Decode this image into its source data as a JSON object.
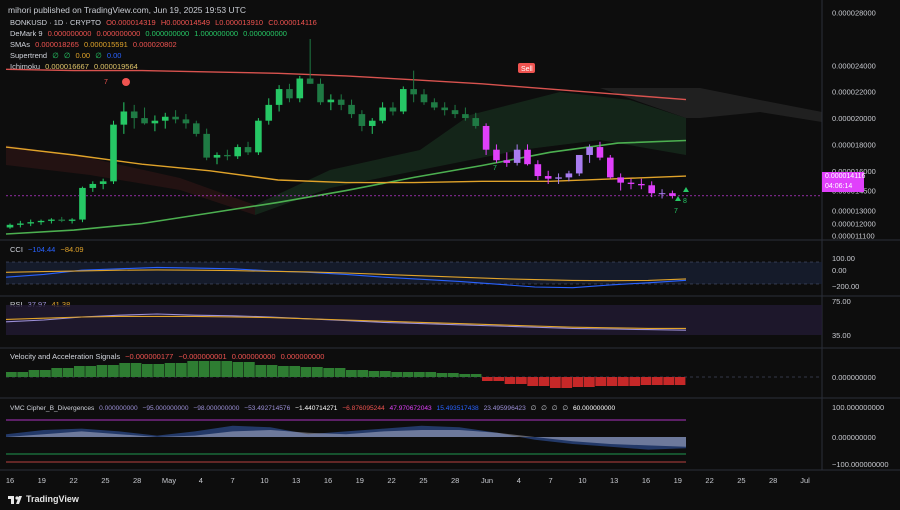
{
  "header": "mihori published on TradingView.com, Jun 19, 2025 19:53 UTC",
  "brand": "TradingView",
  "legends": {
    "main": {
      "symbol": "BONKUSD · 1D · CRYPTO",
      "o": "O0.000014319",
      "h": "H0.000014549",
      "l": "L0.000013910",
      "c": "C0.000014116"
    },
    "demark": {
      "name": "DeMark 9",
      "vals": [
        "0.000000000",
        "0.000000000",
        "0.000000000",
        "1.000000000",
        "0.000000000"
      ]
    },
    "smas": {
      "name": "SMAs",
      "vals": [
        "0.000018265",
        "0.000015591",
        "0.000020802"
      ]
    },
    "supertrend": {
      "name": "Supertrend",
      "vals": [
        "∅",
        "∅",
        "0.00",
        "∅",
        "0.00"
      ]
    },
    "ichimoku": {
      "name": "Ichimoku",
      "vals": [
        "0.000016667",
        "0.000019564"
      ]
    },
    "cci": {
      "name": "CCI",
      "vals": [
        "−104.44",
        "−84.09"
      ]
    },
    "rsi": {
      "name": "RSI",
      "vals": [
        "37.97",
        "41.38"
      ]
    },
    "vel": {
      "name": "Velocity and Acceleration Signals",
      "vals": [
        "−0.000000177",
        "−0.000000001",
        "0.000000000",
        "0.000000000"
      ]
    },
    "vmc": {
      "name": "VMC Cipher_B_Divergences",
      "vals": [
        "0.000000000",
        "−95.000000000",
        "−98.000000000",
        "−53.492714576",
        "−1.440714271",
        "−6.876095244",
        "47.970672043",
        "15.493517438",
        "23.495996423",
        "∅",
        "∅",
        "∅",
        "∅",
        "60.000000000"
      ]
    }
  },
  "annotations": {
    "sell": "Sell",
    "seven_top": "7",
    "seven_mid": "7",
    "seven_low": "7",
    "eight_low": "8"
  },
  "price_box": {
    "price": "0.000014116",
    "countdown": "04:06:14"
  },
  "axes": {
    "price_ticks": [
      "0.000028000",
      "0.000024000",
      "0.000022000",
      "0.000020000",
      "0.000018000",
      "0.000016000",
      "0.000014500",
      "0.000013000",
      "0.000012000",
      "0.000011100"
    ],
    "cci_ticks": [
      "100.00",
      "0.00",
      "−200.00"
    ],
    "rsi_ticks": [
      "75.00",
      "35.00"
    ],
    "vel_ticks": [
      "0.000000000"
    ],
    "vmc_ticks": [
      "100.000000000",
      "0.000000000",
      "−100.000000000"
    ],
    "x_ticks": [
      "16",
      "19",
      "22",
      "25",
      "28",
      "May",
      "4",
      "7",
      "10",
      "13",
      "16",
      "19",
      "22",
      "25",
      "28",
      "Jun",
      "4",
      "7",
      "10",
      "13",
      "16",
      "19",
      "22",
      "25",
      "28",
      "Jul"
    ]
  },
  "colors": {
    "up": "#26c765",
    "down": "#e040fb",
    "sma_green": "#4caf50",
    "sma_yellow": "#e0a32a",
    "sma_red": "#d9534f",
    "cci": "#2962ff",
    "rsi": "#9b8fd6"
  },
  "chart_data": {
    "type": "candlestick",
    "symbol": "BONKUSD",
    "timeframe": "1D",
    "x_start": "2025-04-16",
    "ylim": [
      1.09e-05,
      2.82e-05
    ],
    "candles": [
      [
        1.17e-05,
        1.2e-05,
        1.16e-05,
        1.19e-05
      ],
      [
        1.19e-05,
        1.22e-05,
        1.17e-05,
        1.2e-05
      ],
      [
        1.2e-05,
        1.23e-05,
        1.18e-05,
        1.21e-05
      ],
      [
        1.21e-05,
        1.23e-05,
        1.19e-05,
        1.22e-05
      ],
      [
        1.22e-05,
        1.24e-05,
        1.2e-05,
        1.23e-05
      ],
      [
        1.23e-05,
        1.25e-05,
        1.21e-05,
        1.22e-05
      ],
      [
        1.22e-05,
        1.24e-05,
        1.2e-05,
        1.23e-05
      ],
      [
        1.23e-05,
        1.48e-05,
        1.21e-05,
        1.47e-05
      ],
      [
        1.47e-05,
        1.52e-05,
        1.44e-05,
        1.5e-05
      ],
      [
        1.5e-05,
        1.54e-05,
        1.46e-05,
        1.52e-05
      ],
      [
        1.52e-05,
        1.98e-05,
        1.5e-05,
        1.95e-05
      ],
      [
        1.95e-05,
        2.12e-05,
        1.88e-05,
        2.05e-05
      ],
      [
        2.05e-05,
        2.1e-05,
        1.92e-05,
        2e-05
      ],
      [
        2e-05,
        2.08e-05,
        1.95e-05,
        1.96e-05
      ],
      [
        1.96e-05,
        2.02e-05,
        1.9e-05,
        1.98e-05
      ],
      [
        1.98e-05,
        2.04e-05,
        1.92e-05,
        2.01e-05
      ],
      [
        2.01e-05,
        2.06e-05,
        1.96e-05,
        1.99e-05
      ],
      [
        1.99e-05,
        2.03e-05,
        1.92e-05,
        1.96e-05
      ],
      [
        1.96e-05,
        1.98e-05,
        1.86e-05,
        1.88e-05
      ],
      [
        1.88e-05,
        1.92e-05,
        1.68e-05,
        1.7e-05
      ],
      [
        1.7e-05,
        1.74e-05,
        1.65e-05,
        1.72e-05
      ],
      [
        1.72e-05,
        1.76e-05,
        1.68e-05,
        1.71e-05
      ],
      [
        1.71e-05,
        1.8e-05,
        1.69e-05,
        1.78e-05
      ],
      [
        1.78e-05,
        1.82e-05,
        1.72e-05,
        1.74e-05
      ],
      [
        1.74e-05,
        2e-05,
        1.72e-05,
        1.98e-05
      ],
      [
        1.98e-05,
        2.15e-05,
        1.95e-05,
        2.1e-05
      ],
      [
        2.1e-05,
        2.25e-05,
        2.05e-05,
        2.22e-05
      ],
      [
        2.22e-05,
        2.26e-05,
        2.12e-05,
        2.15e-05
      ],
      [
        2.15e-05,
        2.32e-05,
        2.12e-05,
        2.3e-05
      ],
      [
        2.3e-05,
        2.6e-05,
        2.26e-05,
        2.26e-05
      ],
      [
        2.26e-05,
        2.3e-05,
        2.1e-05,
        2.12e-05
      ],
      [
        2.12e-05,
        2.18e-05,
        2.06e-05,
        2.14e-05
      ],
      [
        2.14e-05,
        2.18e-05,
        2.06e-05,
        2.1e-05
      ],
      [
        2.1e-05,
        2.14e-05,
        2e-05,
        2.03e-05
      ],
      [
        2.03e-05,
        2.06e-05,
        1.9e-05,
        1.94e-05
      ],
      [
        1.94e-05,
        2e-05,
        1.88e-05,
        1.98e-05
      ],
      [
        1.98e-05,
        2.12e-05,
        1.96e-05,
        2.08e-05
      ],
      [
        2.08e-05,
        2.12e-05,
        2.02e-05,
        2.05e-05
      ],
      [
        2.05e-05,
        2.24e-05,
        2.03e-05,
        2.22e-05
      ],
      [
        2.22e-05,
        2.36e-05,
        2.12e-05,
        2.18e-05
      ],
      [
        2.18e-05,
        2.22e-05,
        2.1e-05,
        2.12e-05
      ],
      [
        2.12e-05,
        2.15e-05,
        2.06e-05,
        2.08e-05
      ],
      [
        2.08e-05,
        2.12e-05,
        2.02e-05,
        2.06e-05
      ],
      [
        2.06e-05,
        2.1e-05,
        2e-05,
        2.03e-05
      ],
      [
        2.03e-05,
        2.08e-05,
        1.98e-05,
        2e-05
      ],
      [
        2e-05,
        2.04e-05,
        1.92e-05,
        1.94e-05
      ],
      [
        1.94e-05,
        1.96e-05,
        1.72e-05,
        1.76e-05
      ],
      [
        1.76e-05,
        1.8e-05,
        1.66e-05,
        1.68e-05
      ],
      [
        1.68e-05,
        1.74e-05,
        1.63e-05,
        1.66e-05
      ],
      [
        1.66e-05,
        1.8e-05,
        1.64e-05,
        1.76e-05
      ],
      [
        1.76e-05,
        1.8e-05,
        1.64e-05,
        1.65e-05
      ],
      [
        1.65e-05,
        1.68e-05,
        1.53e-05,
        1.56e-05
      ],
      [
        1.56e-05,
        1.6e-05,
        1.5e-05,
        1.54e-05
      ],
      [
        1.54e-05,
        1.58e-05,
        1.5e-05,
        1.55e-05
      ],
      [
        1.55e-05,
        1.6e-05,
        1.52e-05,
        1.58e-05
      ],
      [
        1.58e-05,
        1.72e-05,
        1.56e-05,
        1.72e-05
      ],
      [
        1.72e-05,
        1.8e-05,
        1.66e-05,
        1.78e-05
      ],
      [
        1.78e-05,
        1.82e-05,
        1.68e-05,
        1.7e-05
      ],
      [
        1.7e-05,
        1.72e-05,
        1.54e-05,
        1.55e-05
      ],
      [
        1.55e-05,
        1.58e-05,
        1.45e-05,
        1.51e-05
      ],
      [
        1.51e-05,
        1.54e-05,
        1.46e-05,
        1.5e-05
      ],
      [
        1.5e-05,
        1.54e-05,
        1.46e-05,
        1.49e-05
      ],
      [
        1.49e-05,
        1.52e-05,
        1.4e-05,
        1.43e-05
      ],
      [
        1.43e-05,
        1.46e-05,
        1.39e-05,
        1.43e-05
      ],
      [
        1.43e-05,
        1.45e-05,
        1.39e-05,
        1.41e-05
      ]
    ],
    "overlays": {
      "sma_red": [
        2.37e-05,
        2.36e-05,
        2.36e-05,
        2.35e-05,
        2.34e-05,
        2.32e-05,
        2.29e-05,
        2.26e-05,
        2.22e-05,
        2.18e-05,
        2.14e-05
      ],
      "sma_green": [
        1.12e-05,
        1.15e-05,
        1.2e-05,
        1.28e-05,
        1.36e-05,
        1.45e-05,
        1.55e-05,
        1.64e-05,
        1.74e-05,
        1.81e-05,
        1.83e-05
      ],
      "sma_yellow": [
        1.78e-05,
        1.72e-05,
        1.65e-05,
        1.6e-05,
        1.53e-05,
        1.51e-05,
        1.51e-05,
        1.52e-05,
        1.52e-05,
        1.54e-05,
        1.56e-05
      ]
    },
    "sub_panels": {
      "cci": {
        "lines": {
          "cci": [
            -60,
            -20,
            40,
            60,
            80,
            70,
            60,
            30,
            10,
            -20,
            -60,
            -90,
            -120,
            -160,
            -200,
            -210,
            -170,
            -140,
            -104
          ],
          "signal": [
            10,
            20,
            30,
            40,
            45,
            40,
            35,
            25,
            15,
            0,
            -20,
            -40,
            -60,
            -80,
            -95,
            -105,
            -110,
            -105,
            -84
          ]
        }
      },
      "rsi": {
        "lines": {
          "rsi": [
            52,
            55,
            60,
            63,
            65,
            63,
            62,
            60,
            57,
            54,
            51,
            49,
            47,
            45,
            43,
            41,
            40,
            39,
            38
          ],
          "ma": [
            56,
            58,
            60,
            61,
            61,
            61,
            60,
            59,
            57,
            55,
            53,
            51,
            49,
            47,
            45,
            43,
            42,
            41,
            41
          ]
        }
      },
      "velocity": {
        "values": [
          0.25,
          0.35,
          0.45,
          0.55,
          0.6,
          0.7,
          0.65,
          0.7,
          0.8,
          0.8,
          0.75,
          0.6,
          0.55,
          0.5,
          0.45,
          0.35,
          0.3,
          0.25,
          0.25,
          0.2,
          0.15,
          -0.2,
          -0.35,
          -0.45,
          -0.55,
          -0.5,
          -0.45,
          -0.45,
          -0.4,
          -0.4
        ]
      },
      "vmc": {
        "wave1": [
          10,
          25,
          30,
          20,
          5,
          20,
          40,
          35,
          10,
          20,
          30,
          40,
          35,
          15,
          -10,
          -25,
          -35,
          -45,
          -40
        ],
        "wave2": [
          0,
          10,
          20,
          10,
          0,
          5,
          20,
          25,
          15,
          10,
          20,
          25,
          25,
          15,
          0,
          -15,
          -25,
          -30,
          -35
        ]
      }
    }
  }
}
